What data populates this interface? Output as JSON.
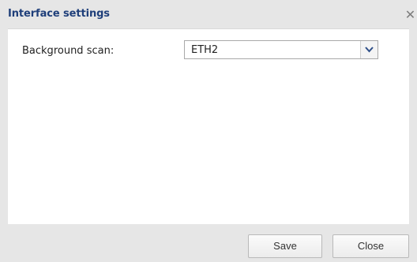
{
  "dialog": {
    "title": "Interface settings",
    "close_icon": "close-icon",
    "close_glyph": "✕"
  },
  "form": {
    "background_scan_label": "Background scan:",
    "background_scan_value": "ETH2",
    "dropdown_icon": "chevron-down-icon"
  },
  "buttons": {
    "save_label": "Save",
    "close_label": "Close"
  },
  "colors": {
    "title": "#1f3f7a",
    "dialog_background": "#e6e6e6",
    "panel_background": "#ffffff",
    "chevron": "#2e4f88"
  }
}
